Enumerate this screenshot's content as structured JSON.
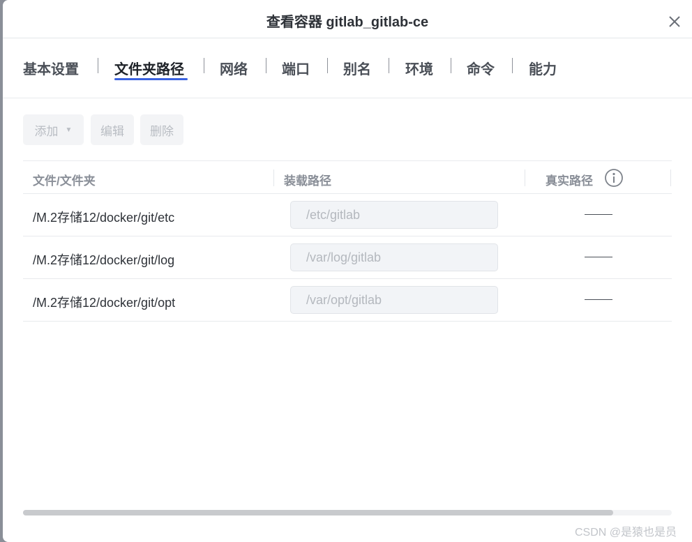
{
  "dialog": {
    "title": "查看容器 gitlab_gitlab-ce"
  },
  "tabs": [
    {
      "label": "基本设置",
      "active": false
    },
    {
      "label": "文件夹路径",
      "active": true
    },
    {
      "label": "网络",
      "active": false
    },
    {
      "label": "端口",
      "active": false
    },
    {
      "label": "别名",
      "active": false
    },
    {
      "label": "环境",
      "active": false
    },
    {
      "label": "命令",
      "active": false
    },
    {
      "label": "能力",
      "active": false
    }
  ],
  "toolbar": {
    "add_label": "添加",
    "edit_label": "编辑",
    "delete_label": "删除"
  },
  "table": {
    "headers": {
      "source": "文件/文件夹",
      "mount": "装载路径",
      "real": "真实路径"
    },
    "rows": [
      {
        "source": "/M.2存储12/docker/git/etc",
        "mount": "/etc/gitlab"
      },
      {
        "source": "/M.2存储12/docker/git/log",
        "mount": "/var/log/gitlab"
      },
      {
        "source": "/M.2存储12/docker/git/opt",
        "mount": "/var/opt/gitlab"
      }
    ]
  },
  "scrollbar": {
    "thumb_fraction": 0.91
  },
  "watermark": "CSDN @是猿也是员",
  "colors": {
    "accent": "#3a62e0",
    "disabled_text": "#b9bdc3",
    "header_text": "#8a8f98"
  },
  "icons": {
    "close": "close-icon",
    "info": "info-icon",
    "dropdown": "caret-down-icon"
  }
}
